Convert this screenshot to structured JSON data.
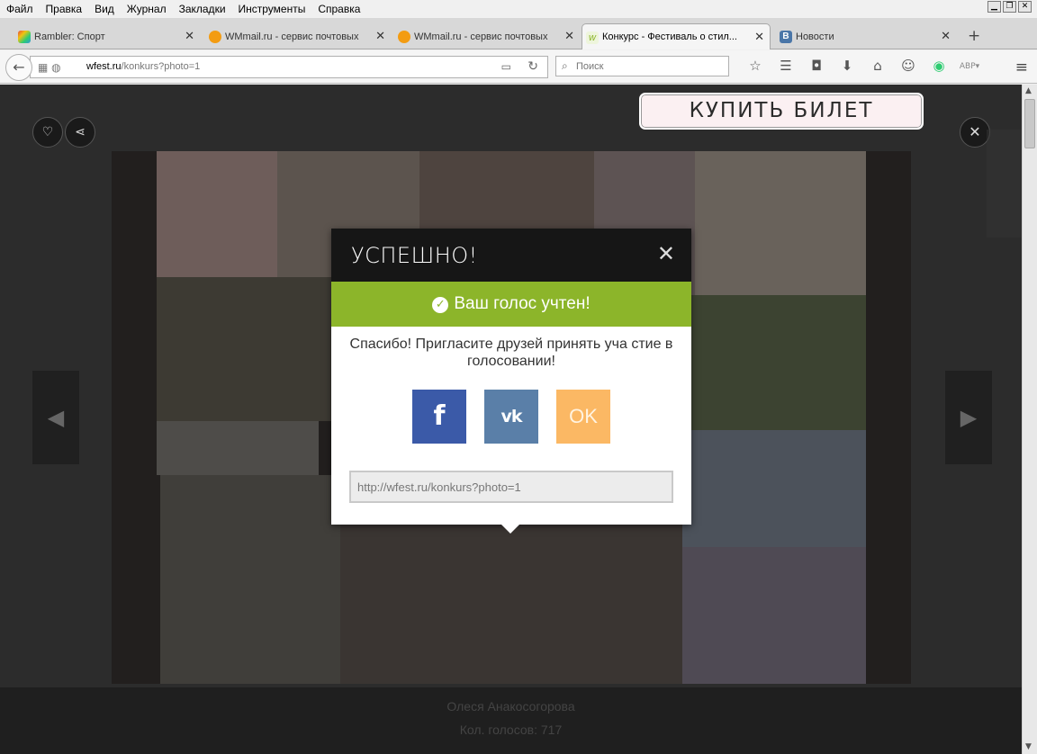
{
  "menubar": {
    "items": [
      "Файл",
      "Правка",
      "Вид",
      "Журнал",
      "Закладки",
      "Инструменты",
      "Справка"
    ],
    "window_controls": [
      "minimize-icon",
      "restore-icon",
      "close-icon"
    ]
  },
  "tabs": [
    {
      "label": "Rambler: Спорт",
      "icon": "rambler-icon",
      "color": "#6aa84f",
      "active": false
    },
    {
      "label": "WMmail.ru - сервис почтовых ...",
      "icon": "wmmail-icon",
      "color": "#f39c12",
      "active": false
    },
    {
      "label": "WMmail.ru - сервис почтовых ...",
      "icon": "wmmail-icon",
      "color": "#f39c12",
      "active": false
    },
    {
      "label": "Конкурс - Фестиваль о стил...",
      "icon": "wfest-icon",
      "color": "#b5d46a",
      "active": true
    },
    {
      "label": "Новости",
      "icon": "vk-icon",
      "color": "#4a76a8",
      "active": false
    }
  ],
  "navbar": {
    "url_host": "wfest.ru",
    "url_path": "/konkurs?photo=1",
    "search_placeholder": "Поиск"
  },
  "page": {
    "buy_ticket": "КУПИТЬ БИЛЕТ",
    "author_name": "Олеся Анакосогорова",
    "votes": "Кол. голосов: 717"
  },
  "modal": {
    "title": "УСПЕШНО!",
    "success_text": "Ваш голос учтен!",
    "invite_text": "Спасибо! Пригласите друзей принять уча стие в голосовании!",
    "facebook_label": "f",
    "vk_label": "vk",
    "ok_label": "OK",
    "share_link": "http://wfest.ru/konkurs?photo=1"
  },
  "colors": {
    "success_green": "#8cb52a",
    "facebook_blue": "#3b5aa8",
    "vk_blue": "#5a7fa8",
    "ok_orange": "#fbb864",
    "modal_header": "#161616"
  }
}
